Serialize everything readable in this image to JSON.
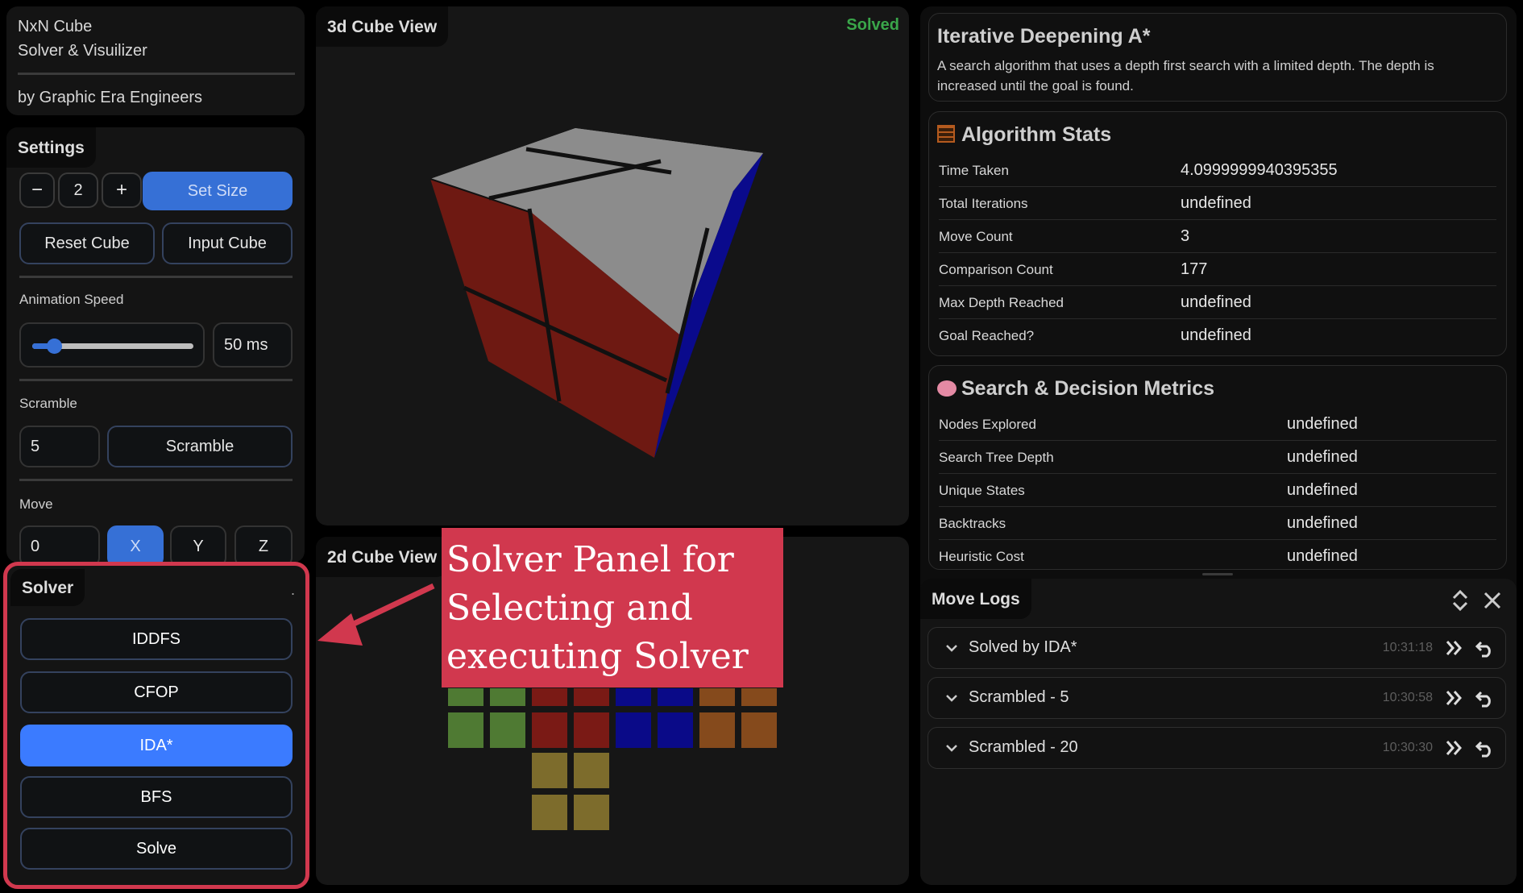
{
  "header": {
    "title_line1": "NxN Cube",
    "title_line2": "Solver & Visuilizer",
    "byline": "by Graphic Era Engineers"
  },
  "settings": {
    "tab": "Settings",
    "size_minus": "−",
    "size_value": "2",
    "size_plus": "+",
    "set_size": "Set Size",
    "reset_cube": "Reset Cube",
    "input_cube": "Input Cube",
    "anim_label": "Animation Speed",
    "anim_value": "50 ms",
    "anim_level": 0.08,
    "scramble_label": "Scramble",
    "scramble_value": "5",
    "scramble_button": "Scramble",
    "move_label": "Move",
    "move_value": "0",
    "axis_x": "X",
    "axis_y": "Y",
    "axis_z": "Z"
  },
  "solver": {
    "tab": "Solver",
    "dot": ".",
    "options": [
      "IDDFS",
      "CFOP",
      "IDA*",
      "BFS",
      "Solve"
    ],
    "active_index": 2
  },
  "view3d": {
    "tab": "3d Cube View",
    "status": "Solved"
  },
  "view2d": {
    "tab": "2d Cube View"
  },
  "annotation": {
    "lines": [
      "Solver Panel for",
      "Selecting and",
      "executing Solver"
    ]
  },
  "algorithm": {
    "name": "Iterative Deepening A*",
    "description": "A search algorithm that uses a depth first search with a limited depth. The depth is increased until the goal is found."
  },
  "algorithm_stats": {
    "icon": "abacus-icon",
    "title": "Algorithm Stats",
    "rows": [
      {
        "k": "Time Taken",
        "v": "4.0999999940395355"
      },
      {
        "k": "Total Iterations",
        "v": "undefined"
      },
      {
        "k": "Move Count",
        "v": "3"
      },
      {
        "k": "Comparison Count",
        "v": "177"
      },
      {
        "k": "Max Depth Reached",
        "v": "undefined"
      },
      {
        "k": "Goal Reached?",
        "v": "undefined"
      }
    ]
  },
  "search_metrics": {
    "icon": "brain-icon",
    "title": "Search & Decision Metrics",
    "rows": [
      {
        "k": "Nodes Explored",
        "v": "undefined"
      },
      {
        "k": "Search Tree Depth",
        "v": "undefined"
      },
      {
        "k": "Unique States",
        "v": "undefined"
      },
      {
        "k": "Backtracks",
        "v": "undefined"
      },
      {
        "k": "Heuristic Cost",
        "v": "undefined"
      }
    ]
  },
  "move_logs": {
    "tab": "Move Logs",
    "entries": [
      {
        "text": "Solved by IDA*",
        "time": "10:31:18"
      },
      {
        "text": "Scrambled - 5",
        "time": "10:30:58"
      },
      {
        "text": "Scrambled - 20",
        "time": "10:30:30"
      }
    ]
  },
  "colors": {
    "accent": "#3b7bff",
    "annotation": "#d1384e",
    "highlight_border": "#d1384e",
    "solved": "#3aa64a",
    "cube_top": "#8c8c8c",
    "cube_front": "#6e1912",
    "cube_right": "#0a0a8c",
    "face_green": "#4f7a33",
    "face_red": "#7a1a15",
    "face_blue": "#0a0a88",
    "face_orange": "#854a1c",
    "face_yellow": "#7d6c2c"
  }
}
